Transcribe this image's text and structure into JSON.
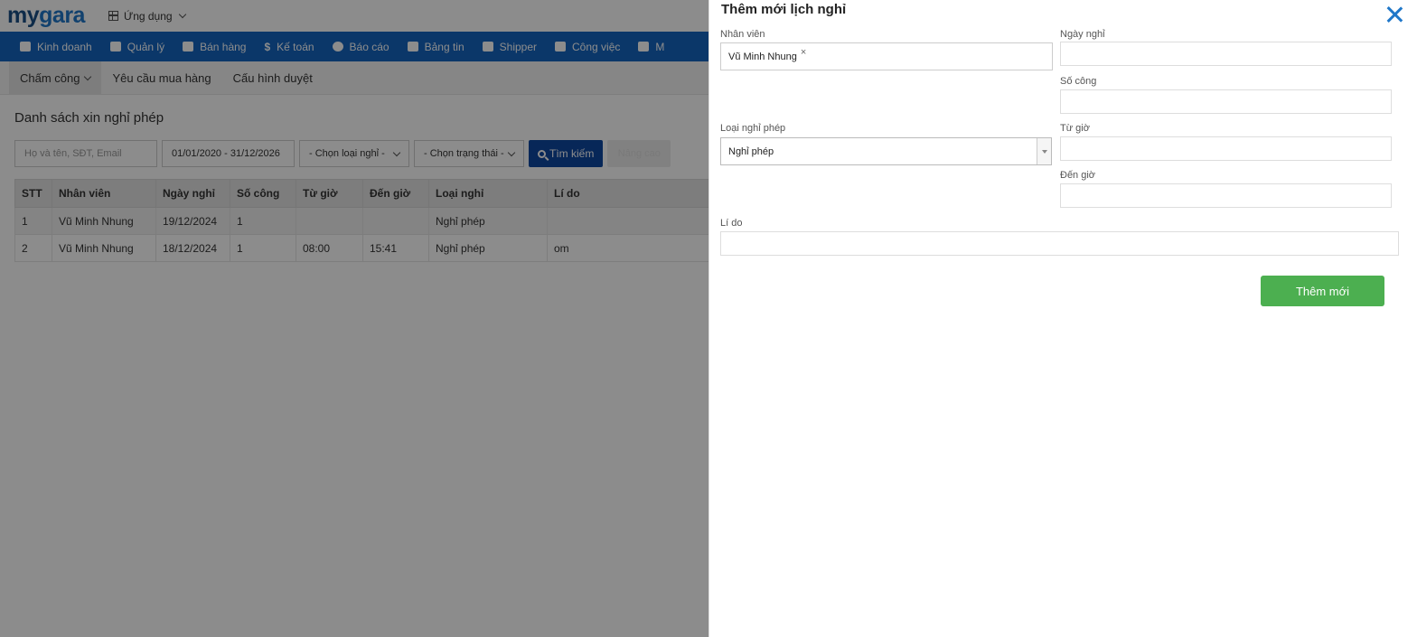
{
  "topbar": {
    "logo_part1": "my",
    "logo_part2": "gara",
    "apps_label": "Ứng dụng"
  },
  "nav": [
    {
      "label": "Kinh doanh",
      "icon": "briefcase-icon"
    },
    {
      "label": "Quản lý",
      "icon": "id-card-icon"
    },
    {
      "label": "Bán hàng",
      "icon": "cart-icon"
    },
    {
      "label": "Kế toán",
      "icon": "dollar-icon"
    },
    {
      "label": "Báo cáo",
      "icon": "pie-chart-icon"
    },
    {
      "label": "Bảng tin",
      "icon": "home-icon"
    },
    {
      "label": "Shipper",
      "icon": "truck-icon"
    },
    {
      "label": "Công việc",
      "icon": "calendar-icon"
    },
    {
      "label": "M",
      "icon": "basket-icon"
    }
  ],
  "subnav": {
    "items": [
      "Chấm công",
      "Yêu cầu mua hàng",
      "Cấu hình duyệt"
    ]
  },
  "list": {
    "title": "Danh sách xin nghỉ phép",
    "search_placeholder": "Họ và tên, SĐT, Email",
    "date_range": "01/01/2020 - 31/12/2026",
    "leave_type_select": "- Chọn loại nghỉ -",
    "status_select": "- Chọn trạng thái -",
    "search_button": "Tìm kiếm",
    "disabled_button": "Nâng cao",
    "columns": [
      "STT",
      "Nhân viên",
      "Ngày nghỉ",
      "Số công",
      "Từ giờ",
      "Đến giờ",
      "Loại nghỉ",
      "Lí do"
    ],
    "rows": [
      [
        "1",
        "Vũ Minh Nhung",
        "19/12/2024",
        "1",
        "",
        "",
        "Nghỉ phép",
        ""
      ],
      [
        "2",
        "Vũ Minh Nhung",
        "18/12/2024",
        "1",
        "08:00",
        "15:41",
        "Nghỉ phép",
        "om"
      ]
    ]
  },
  "drawer": {
    "title": "Thêm mới lịch nghỉ",
    "employee_label": "Nhân viên",
    "employee_tag": "Vũ Minh Nhung",
    "employee_tag_remove": "×",
    "date_label": "Ngày nghỉ",
    "date_value": "",
    "workdays_label": "Số công",
    "workdays_value": "",
    "leave_type_label": "Loại nghỉ phép",
    "leave_type_value": "Nghỉ phép",
    "from_label": "Từ giờ",
    "from_value": "",
    "to_label": "Đến giờ",
    "to_value": "",
    "reason_label": "Lí do",
    "reason_value": "",
    "submit_label": "Thêm mới"
  }
}
